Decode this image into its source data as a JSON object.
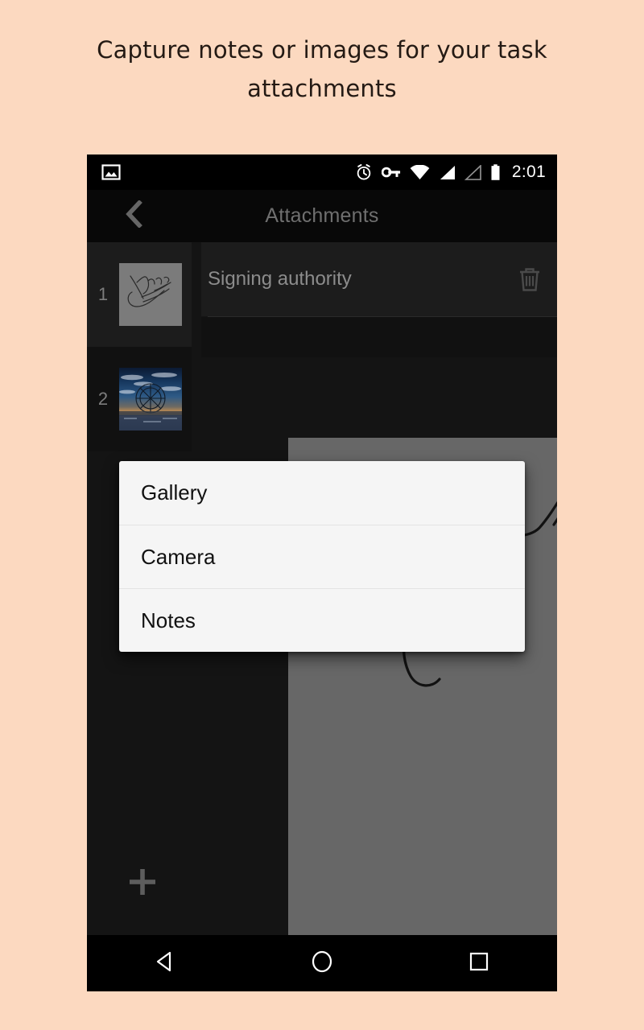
{
  "promo": {
    "caption_line1": "Capture notes or images for your task",
    "caption_line2": "attachments"
  },
  "colors": {
    "page_background": "#fcd9c0",
    "phone_background": "#000000",
    "toolbar_background": "#080808",
    "content_background": "#141414",
    "row_selected": "#1c1c1c",
    "canvas": "#676767",
    "dialog_background": "#f5f5f5",
    "title_text": "#6f6f6f",
    "body_text": "#8c8c8c",
    "dialog_text": "#111111"
  },
  "status_bar": {
    "time": "2:01",
    "icons": [
      "image-icon",
      "alarm-clock-icon",
      "vpn-key-icon",
      "wifi-icon",
      "signal-full-icon",
      "signal-empty-icon",
      "battery-icon"
    ]
  },
  "toolbar": {
    "back_icon": "back-chevron-icon",
    "title": "Attachments"
  },
  "attachments": {
    "items": [
      {
        "index": "1",
        "title": "Signing authority",
        "thumbnail": "signature-sketch-thumbnail",
        "selected": true,
        "delete_icon": "trash-icon"
      },
      {
        "index": "2",
        "title": "",
        "thumbnail": "ferris-wheel-photo-thumbnail",
        "selected": false,
        "delete_icon": "trash-icon"
      }
    ],
    "add_label": "+",
    "add_icon": "plus-icon"
  },
  "dialog": {
    "options": [
      {
        "label": "Gallery"
      },
      {
        "label": "Camera"
      },
      {
        "label": "Notes"
      }
    ]
  },
  "nav_bar": {
    "buttons": [
      {
        "name": "back",
        "icon": "triangle-back-icon"
      },
      {
        "name": "home",
        "icon": "circle-home-icon"
      },
      {
        "name": "recents",
        "icon": "square-recents-icon"
      }
    ]
  }
}
